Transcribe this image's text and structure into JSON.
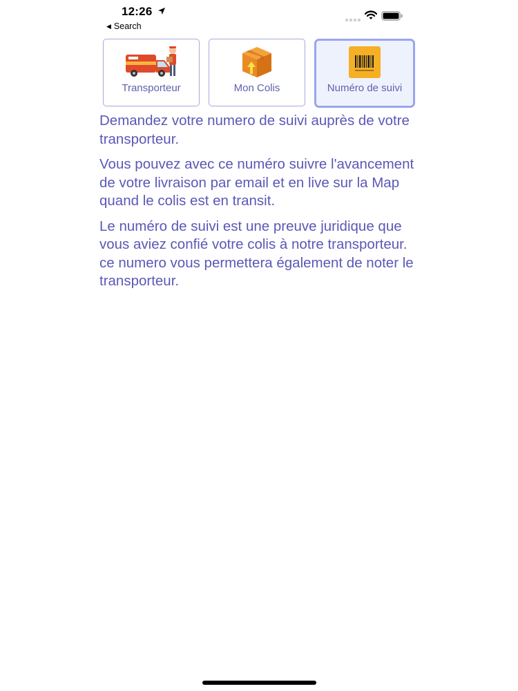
{
  "status_bar": {
    "time": "12:26",
    "back_label": "Search"
  },
  "segments": [
    {
      "label": "Transporteur",
      "icon": "delivery-van-icon",
      "selected": false
    },
    {
      "label": "Mon Colis",
      "icon": "package-box-icon",
      "selected": false
    },
    {
      "label": "Numéro de suivi",
      "icon": "barcode-icon",
      "selected": true
    }
  ],
  "content": {
    "paragraphs": [
      "Demandez votre numero de suivi auprès de votre transporteur.",
      "Vous pouvez avec ce numéro suivre l'avancement de votre livraison par email et en live sur la Map quand le colis est en transit.",
      "Le numéro de suivi est une preuve juridique que vous aviez confié votre colis à notre transporteur. ce numero vous permettera également de noter le transporteur."
    ]
  },
  "colors": {
    "accent_text": "#5b58b6",
    "segment_border": "#a8a9dc",
    "selected_border": "#9aa5ee",
    "selected_background": "#eef2fd"
  }
}
